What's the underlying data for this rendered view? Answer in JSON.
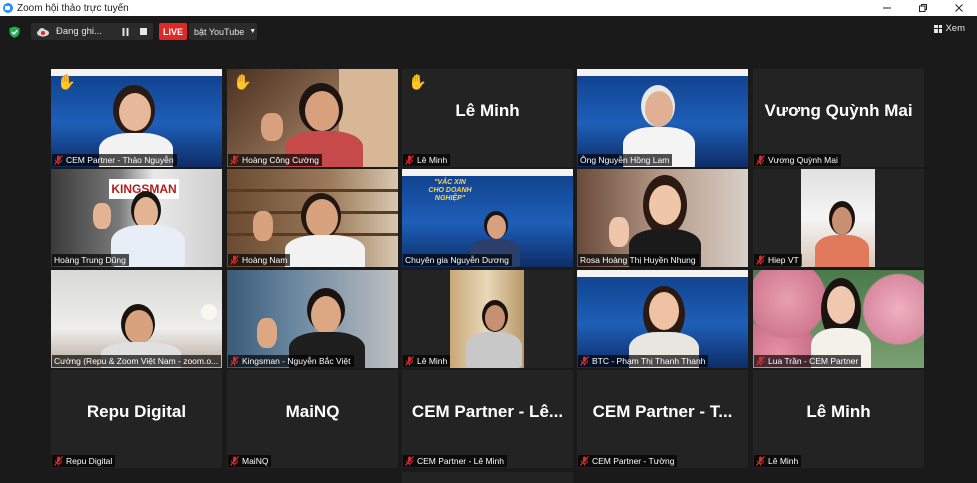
{
  "window": {
    "title": "Zoom hội thảo trực tuyến"
  },
  "toolbar": {
    "recording_label": "Đang ghi...",
    "live_label": "LIVE",
    "stream_label": "bật YouTube",
    "view_label": "Xem"
  },
  "colors": {
    "live_red": "#e02828",
    "active_speaker": "#c8e640",
    "muted_mic": "#e02828",
    "raise_hand": "#ffb400",
    "tile_bg": "#232323"
  },
  "participants": [
    {
      "name": "CEM Partner - Thảo Nguyễn",
      "muted": true,
      "hand": true,
      "video": true
    },
    {
      "name": "Hoàng Công Cường",
      "muted": true,
      "hand": true,
      "video": true
    },
    {
      "name": "Lê Minh",
      "display": "Lê Minh",
      "muted": true,
      "hand": true,
      "video": false
    },
    {
      "name": "Ông Nguyễn Hồng Lam",
      "muted": false,
      "hand": false,
      "video": true
    },
    {
      "name": "Vương Quỳnh Mai",
      "display": "Vương Quỳnh Mai",
      "muted": true,
      "hand": false,
      "video": false
    },
    {
      "name": "Hoàng Trung Dũng",
      "muted": false,
      "hand": false,
      "video": true,
      "active": true
    },
    {
      "name": "Hoàng Nam",
      "muted": true,
      "hand": false,
      "video": true
    },
    {
      "name": "Chuyên gia Nguyễn Dương",
      "muted": false,
      "hand": false,
      "video": true
    },
    {
      "name": "Rosa Hoàng Thị Huyền Nhung",
      "muted": false,
      "hand": false,
      "video": true
    },
    {
      "name": "Hiep VT",
      "muted": true,
      "hand": false,
      "video": true
    },
    {
      "name": "Cường (Repu & Zoom Việt Nam - zoom.o...",
      "muted": false,
      "hand": false,
      "video": true
    },
    {
      "name": "Kingsman - Nguyễn Bắc Việt",
      "muted": true,
      "hand": false,
      "video": true
    },
    {
      "name": "Lê Minh",
      "muted": true,
      "hand": false,
      "video": true
    },
    {
      "name": "BTC - Phạm Thị Thanh Thanh",
      "muted": true,
      "hand": false,
      "video": true
    },
    {
      "name": "Lua Trần - CEM Partner",
      "muted": true,
      "hand": false,
      "video": true
    },
    {
      "name": "Repu Digital",
      "display": "Repu Digital",
      "muted": true,
      "hand": false,
      "video": false
    },
    {
      "name": "MaiNQ",
      "display": "MaiNQ",
      "muted": true,
      "hand": false,
      "video": false
    },
    {
      "name": "CEM Partner - Lê Minh",
      "display": "CEM Partner - Lê...",
      "muted": true,
      "hand": false,
      "video": false
    },
    {
      "name": "CEM Partner - Tường",
      "display": "CEM Partner - T...",
      "muted": true,
      "hand": false,
      "video": false
    },
    {
      "name": "Lê Minh",
      "display": "Lê Minh",
      "muted": true,
      "hand": false,
      "video": false
    }
  ],
  "banner": {
    "title": "\"VẮC XIN CHO DOANH NGHIỆP\""
  }
}
